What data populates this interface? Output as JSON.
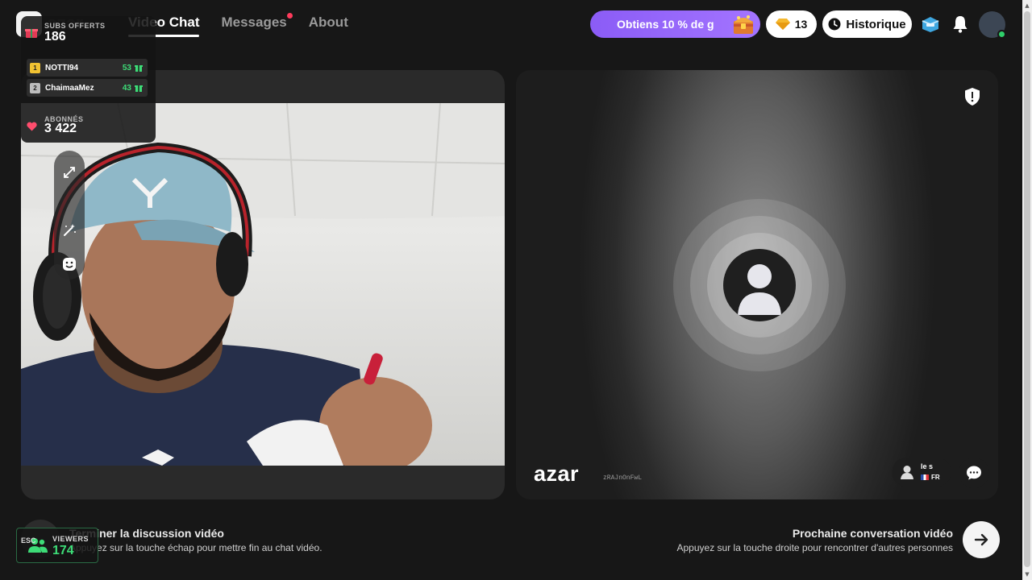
{
  "header": {
    "logo_text": "azar",
    "nav": [
      {
        "label": "Video Chat",
        "active": true
      },
      {
        "label": "Messages",
        "has_notification": true
      },
      {
        "label": "About"
      }
    ],
    "promo_label": "Obtiens 10 % de ɡ",
    "gems_count": "13",
    "history_label": "Historique"
  },
  "overlay": {
    "subs_label": "SUBS OFFERTS",
    "subs_count": "186",
    "leaderboard": [
      {
        "rank": "1",
        "name": "NOTTI94",
        "score": "53"
      },
      {
        "rank": "2",
        "name": "ChaimaaMez",
        "score": "43"
      }
    ],
    "followers_label": "ABONNÉS",
    "followers_count": "3 422"
  },
  "remote": {
    "brand": "azar",
    "id_text": "zRAJnOnFwL",
    "peer_name": "le s",
    "peer_country": "FR"
  },
  "bottom": {
    "end_title": "Terminer la discussion vidéo",
    "end_subtitle": "Appuyez sur la touche échap pour mettre fin au chat vidéo.",
    "esc_label": "ESC",
    "next_title": "Prochaine conversation vidéo",
    "next_subtitle": "Appuyez sur la touche droite pour rencontrer d'autres personnes",
    "viewers_label": "VIEWERS",
    "viewers_count": "174"
  },
  "colors": {
    "accent_purple": "#8b5cf6",
    "notification_red": "#ff3b5c",
    "success_green": "#3ddc77",
    "background": "#171717"
  }
}
